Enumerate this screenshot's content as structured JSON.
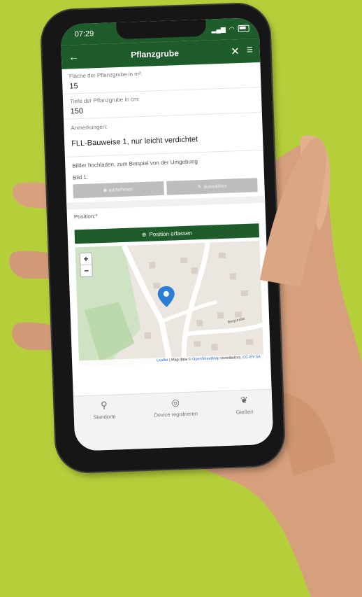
{
  "status": {
    "time": "07:29"
  },
  "appbar": {
    "title": "Pflanzgrube",
    "back_icon": "arrow-left-icon",
    "close_icon": "close-icon",
    "menu_icon": "menu-icon"
  },
  "form": {
    "area_label": "Fläche der Pflanzgrube in m²:",
    "area_value": "15",
    "depth_label": "Tiefe der Pflanzgrube in cm:",
    "depth_value": "150",
    "notes_label": "Anmerkungen:",
    "notes_value": "FLL-Bauweise 1, nur leicht verdichtet"
  },
  "upload": {
    "label": "Bilder hochladen, zum Beispiel von der Umgebung",
    "image_label": "Bild 1:",
    "capture_button": "aufnehmen",
    "select_button": "auswählen"
  },
  "position": {
    "label": "Position:*",
    "capture_button": "Position erfassen"
  },
  "map": {
    "attribution_leaflet": "Leaflet",
    "attribution_text": " | Map data © ",
    "attribution_osm": "OpenStreetMap",
    "attribution_contrib": " contributors, ",
    "attribution_license": "CC-BY-SA",
    "street_label": "Bergstraße",
    "zoom_in": "+",
    "zoom_out": "−"
  },
  "tabs": [
    {
      "label": "Standorte",
      "icon": "location-pin-icon"
    },
    {
      "label": "Device registrieren",
      "icon": "target-icon"
    },
    {
      "label": "Gießen",
      "icon": "leaf-icon"
    }
  ],
  "colors": {
    "background": "#b5cf3a",
    "primary": "#1f5c2c"
  }
}
